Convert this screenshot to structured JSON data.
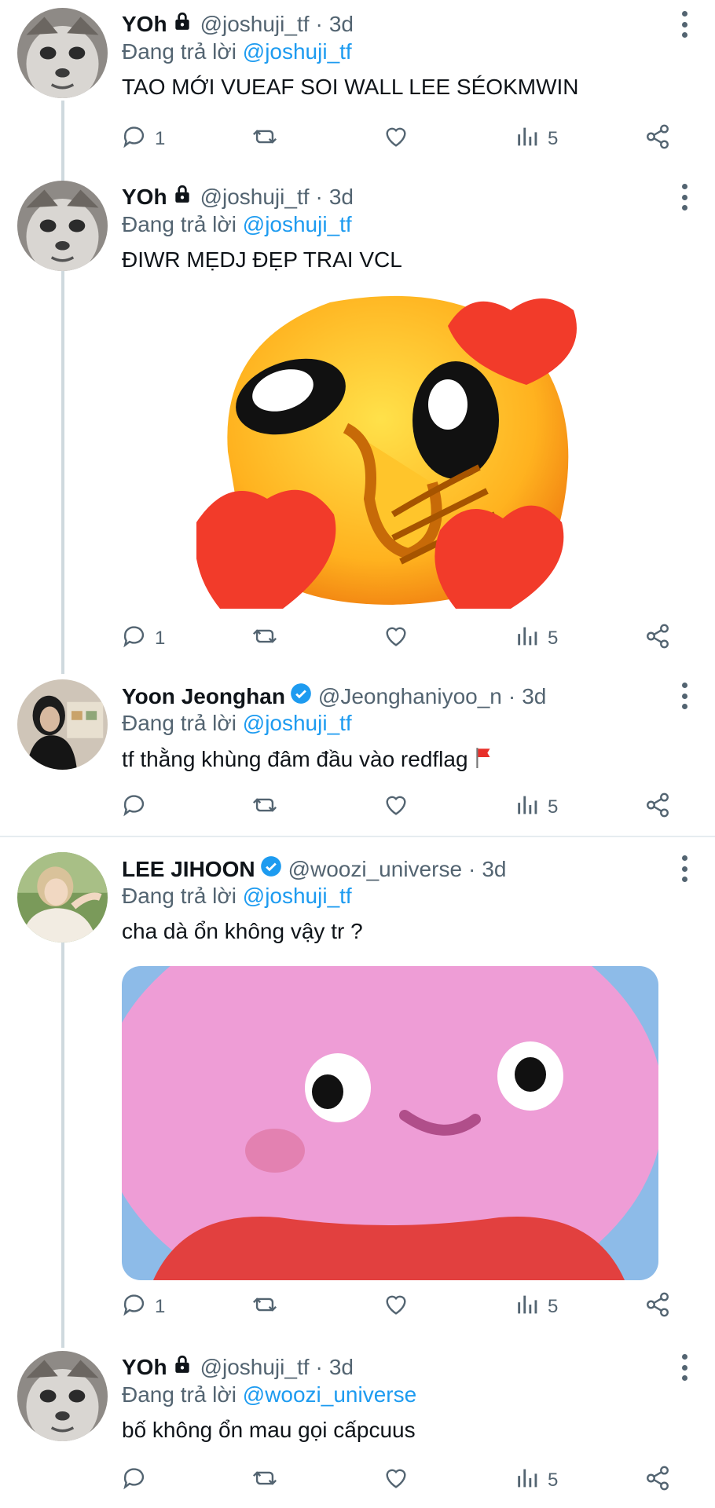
{
  "tweets": [
    {
      "name": "YOh",
      "handle": "@joshuji_tf",
      "time": "3d",
      "reply_prefix": "Đang trả lời",
      "reply_to": "@joshuji_tf",
      "text": "TAO MỚI VUEAF SOI WALL LEE SÉOKMWIN",
      "reply_count": "1",
      "view_count": "5"
    },
    {
      "name": "YOh",
      "handle": "@joshuji_tf",
      "time": "3d",
      "reply_prefix": "Đang trả lời",
      "reply_to": "@joshuji_tf",
      "text": "ĐIWR MẸDJ ĐẸP TRAI VCL",
      "reply_count": "1",
      "view_count": "5",
      "media": "pleading-face-hearts-sticker"
    },
    {
      "name": "Yoon Jeonghan",
      "handle": "@Jeonghaniyoo_n",
      "time": "3d",
      "reply_prefix": "Đang trả lời",
      "reply_to": "@joshuji_tf",
      "text": "tf thằng khùng đâm đầu vào redflag",
      "reply_count": "",
      "view_count": "5"
    },
    {
      "name": "LEE JIHOON",
      "handle": "@woozi_universe",
      "time": "3d",
      "reply_prefix": "Đang trả lời",
      "reply_to": "@joshuji_tf",
      "text": "cha dà ổn không vậy tr ?",
      "reply_count": "1",
      "view_count": "5",
      "media": "pink-cartoon-face-meme"
    },
    {
      "name": "YOh",
      "handle": "@joshuji_tf",
      "time": "3d",
      "reply_prefix": "Đang trả lời",
      "reply_to": "@woozi_universe",
      "text": "bố không ổn mau gọi cấpcuus",
      "reply_count": "",
      "view_count": "5"
    }
  ],
  "sep": "·",
  "icons": {
    "reply": "reply-icon",
    "retweet": "retweet-icon",
    "like": "heart-icon",
    "views": "views-icon",
    "share": "share-icon",
    "more": "more-icon",
    "lock": "lock-icon",
    "verified": "verified-badge-icon",
    "flag": "red-flag-icon"
  },
  "colors": {
    "accent": "#1d9bf0",
    "muted": "#536471",
    "thread_line": "#cfd9de"
  }
}
